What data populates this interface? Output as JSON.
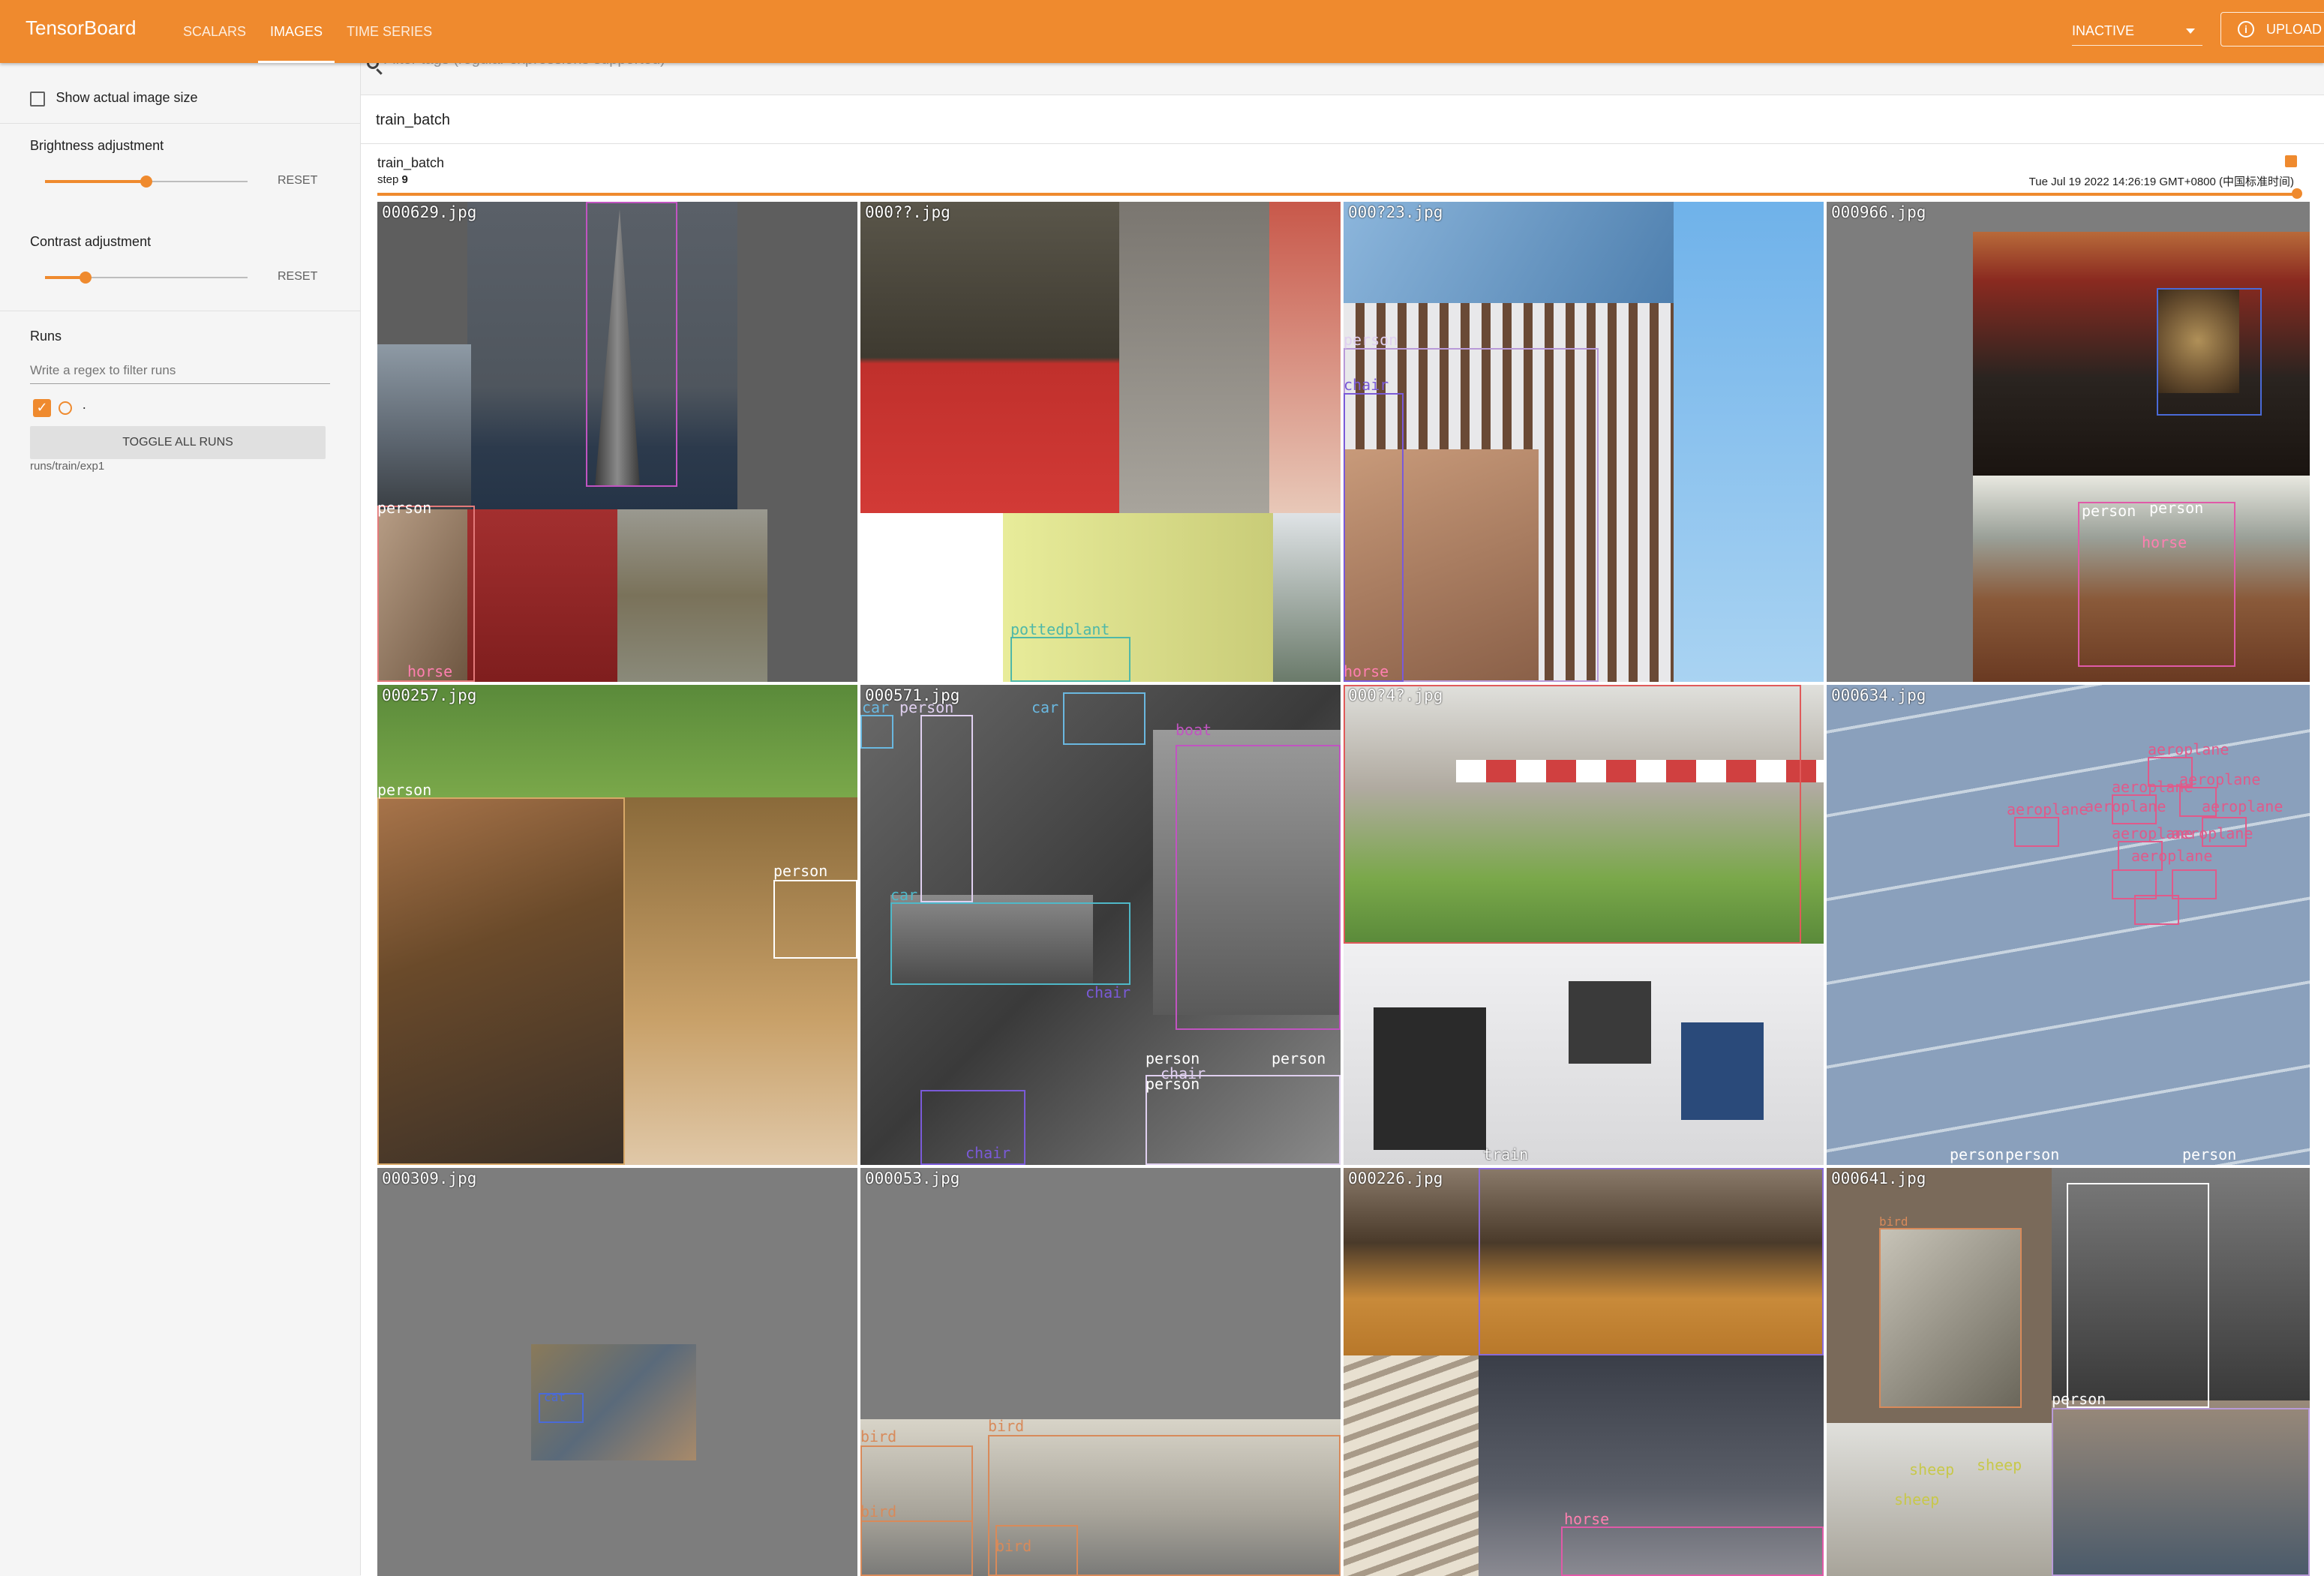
{
  "topbar": {
    "brand": "TensorBoard",
    "tabs": [
      "SCALARS",
      "IMAGES",
      "TIME SERIES"
    ],
    "active_tab": "IMAGES",
    "status": "INACTIVE",
    "upload": "UPLOAD",
    "accent": "#ef8a2e"
  },
  "sidebar": {
    "show_actual_size": "Show actual image size",
    "brightness": {
      "title": "Brightness adjustment",
      "level": 0.5,
      "reset": "RESET"
    },
    "contrast": {
      "title": "Contrast adjustment",
      "level": 0.2,
      "reset": "RESET"
    },
    "runs_title": "Runs",
    "runs_filter_placeholder": "Write a regex to filter runs",
    "run_dot_label": ".",
    "toggle_all": "TOGGLE ALL RUNS",
    "run_path": "runs/train/exp1"
  },
  "main": {
    "tag_filter_placeholder": "Filter tags (regular expressions supported)",
    "group_title": "train_batch",
    "card": {
      "title": "train_batch",
      "step_label": "step",
      "step": "9",
      "timestamp": "Tue Jul 19 2022 14:26:19 GMT+0800 (中国标准时间)"
    }
  },
  "tiles": [
    {
      "fname": "000629.jpg",
      "labels": [
        "person",
        "horse"
      ]
    },
    {
      "fname": "000??.jpg",
      "labels": [
        "pottedplant"
      ]
    },
    {
      "fname": "000?23.jpg",
      "labels": [
        "person",
        "chair",
        "horse"
      ]
    },
    {
      "fname": "000966.jpg",
      "labels": [
        "person",
        "person",
        "horse"
      ]
    },
    {
      "fname": "000257.jpg",
      "labels": [
        "person",
        "person"
      ]
    },
    {
      "fname": "000571.jpg",
      "labels": [
        "car",
        "person",
        "car",
        "boat",
        "car",
        "chair",
        "person",
        "person",
        "chair",
        "person",
        "chair"
      ]
    },
    {
      "fname": "000?4?.jpg",
      "labels": [
        "train"
      ]
    },
    {
      "fname": "000634.jpg",
      "labels": [
        "aeroplane",
        "aeroplane",
        "aeroplane",
        "aeroplane",
        "aeroplane",
        "aeroplane",
        "aeroplane",
        "aeroplane",
        "aeroplane",
        "person",
        "person",
        "person"
      ]
    },
    {
      "fname": "000309.jpg",
      "labels": [
        "cat"
      ]
    },
    {
      "fname": "000053.jpg",
      "labels": [
        "bird",
        "bird",
        "bird",
        "bird"
      ]
    },
    {
      "fname": "000226.jpg",
      "labels": [
        "horse"
      ]
    },
    {
      "fname": "000641.jpg",
      "labels": [
        "bird",
        "person",
        "sheep",
        "sheep",
        "sheep"
      ]
    }
  ]
}
